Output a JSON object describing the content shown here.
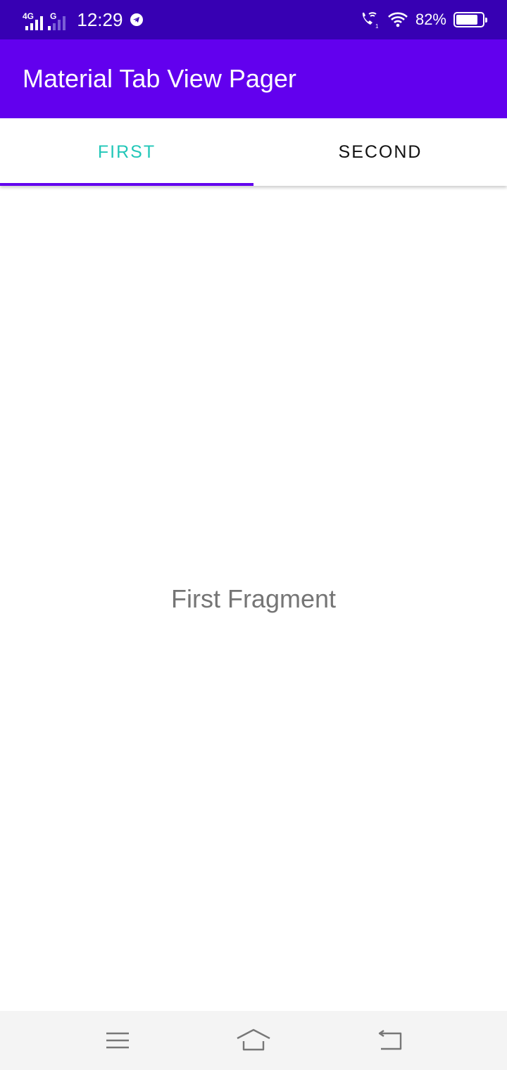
{
  "status_bar": {
    "network_1": "4G",
    "network_2": "G",
    "time": "12:29",
    "battery_percent": "82%",
    "battery_level": 0.82,
    "icons": [
      "signal-icon",
      "telegram-icon",
      "wifi-call-icon",
      "wifi-icon",
      "battery-icon"
    ]
  },
  "app_bar": {
    "title": "Material Tab View Pager",
    "color": "#6200EE"
  },
  "tabs": [
    {
      "label": "FIRST",
      "selected": true
    },
    {
      "label": "SECOND",
      "selected": false
    }
  ],
  "colors": {
    "status_bar": "#3700B3",
    "primary": "#6200EE",
    "tab_active_text": "#22C7B8",
    "fragment_text": "#757575"
  },
  "content": {
    "fragment_text": "First Fragment"
  },
  "nav_bar": {
    "buttons": [
      "menu-icon",
      "home-icon",
      "back-icon"
    ]
  }
}
